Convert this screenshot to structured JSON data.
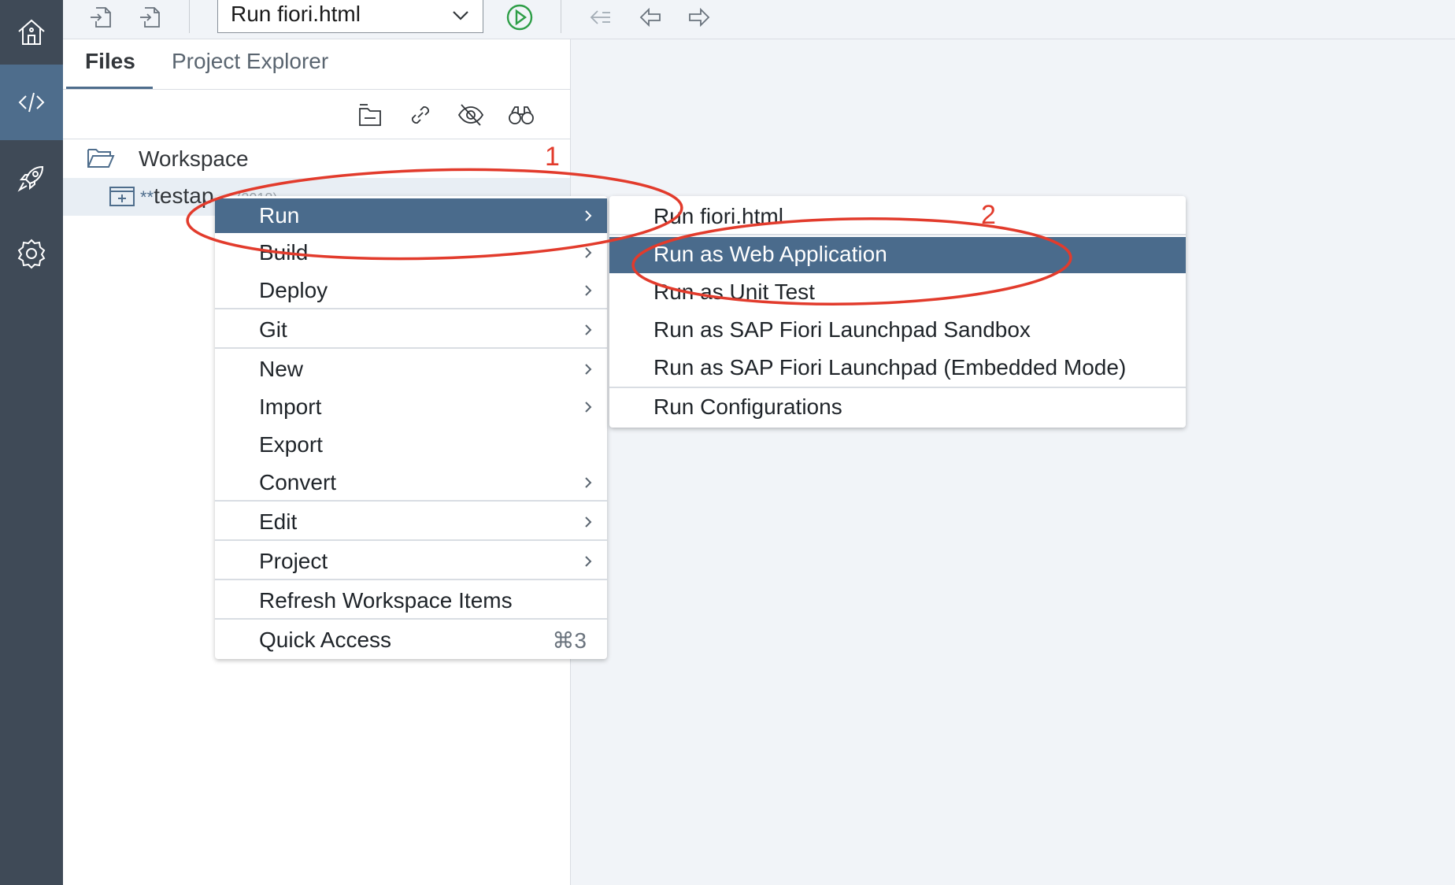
{
  "toolbar": {
    "run_config_selected": "Run fiori.html"
  },
  "panel": {
    "tabs": [
      "Files",
      "Project Explorer"
    ],
    "tree": {
      "workspace_label": "Workspace",
      "project_prefix": "**",
      "project_name": "testap",
      "project_suffix": "...(2018)"
    }
  },
  "context_menu": {
    "items": [
      {
        "label": "Run",
        "submenu": true,
        "highlighted": true
      },
      {
        "label": "Build",
        "submenu": true
      },
      {
        "label": "Deploy",
        "submenu": true
      },
      {
        "label": "Git",
        "submenu": true
      },
      {
        "label": "New",
        "submenu": true
      },
      {
        "label": "Import",
        "submenu": true
      },
      {
        "label": "Export",
        "submenu": false
      },
      {
        "label": "Convert",
        "submenu": true
      },
      {
        "label": "Edit",
        "submenu": true
      },
      {
        "label": "Project",
        "submenu": true
      },
      {
        "label": "Refresh Workspace Items",
        "submenu": false
      },
      {
        "label": "Quick Access",
        "submenu": false,
        "shortcut": "⌘3"
      }
    ]
  },
  "run_submenu": {
    "items": [
      {
        "label": "Run fiori.html"
      },
      {
        "label": "Run as Web Application",
        "highlighted": true
      },
      {
        "label": "Run as Unit Test"
      },
      {
        "label": "Run as SAP Fiori Launchpad Sandbox"
      },
      {
        "label": "Run as SAP Fiori Launchpad (Embedded Mode)"
      },
      {
        "label": "Run Configurations"
      }
    ]
  },
  "annotations": {
    "step1": "1",
    "step2": "2",
    "color": "#e23b2c"
  },
  "icons": {
    "rail": [
      "home-icon",
      "code-icon",
      "rocket-icon",
      "gear-icon"
    ],
    "toolbar": [
      "import-icon",
      "export-icon",
      "chevron-down-icon",
      "run-play-icon",
      "back-to-edit-icon",
      "back-icon",
      "forward-icon"
    ],
    "panel": [
      "collapse-all-icon",
      "link-icon",
      "hide-icon",
      "search-binoculars-icon",
      "folder-open-icon",
      "project-folder-icon"
    ]
  },
  "colors": {
    "rail": "#3f4a57",
    "rail_active": "#4e6d8c",
    "highlight": "#4a6b8c",
    "run_green": "#2e9e47"
  }
}
